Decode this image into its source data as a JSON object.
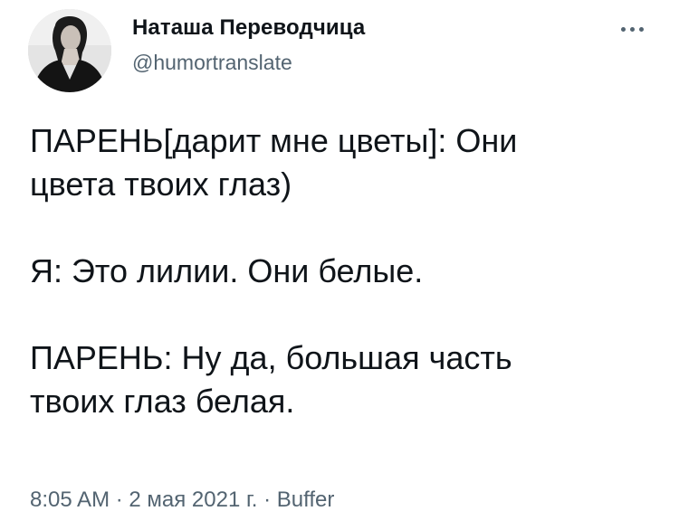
{
  "author": {
    "display_name": "Наташа Переводчица",
    "handle": "@humortranslate"
  },
  "menu": {
    "icon": "more-horizontal-icon"
  },
  "tweet": {
    "paragraphs": [
      "ПАРЕНЬ[дарит мне цветы]: Они\nцвета твоих глаз)",
      "Я: Это лилии. Они белые.",
      "ПАРЕНЬ: Ну да, большая часть\nтвоих глаз белая."
    ]
  },
  "meta": {
    "time": "8:05 AM",
    "sep1": " · ",
    "date": "2 мая 2021 г.",
    "sep2": " · ",
    "source": "Buffer"
  },
  "colors": {
    "text": "#0f1419",
    "secondary": "#536471",
    "background": "#ffffff"
  }
}
